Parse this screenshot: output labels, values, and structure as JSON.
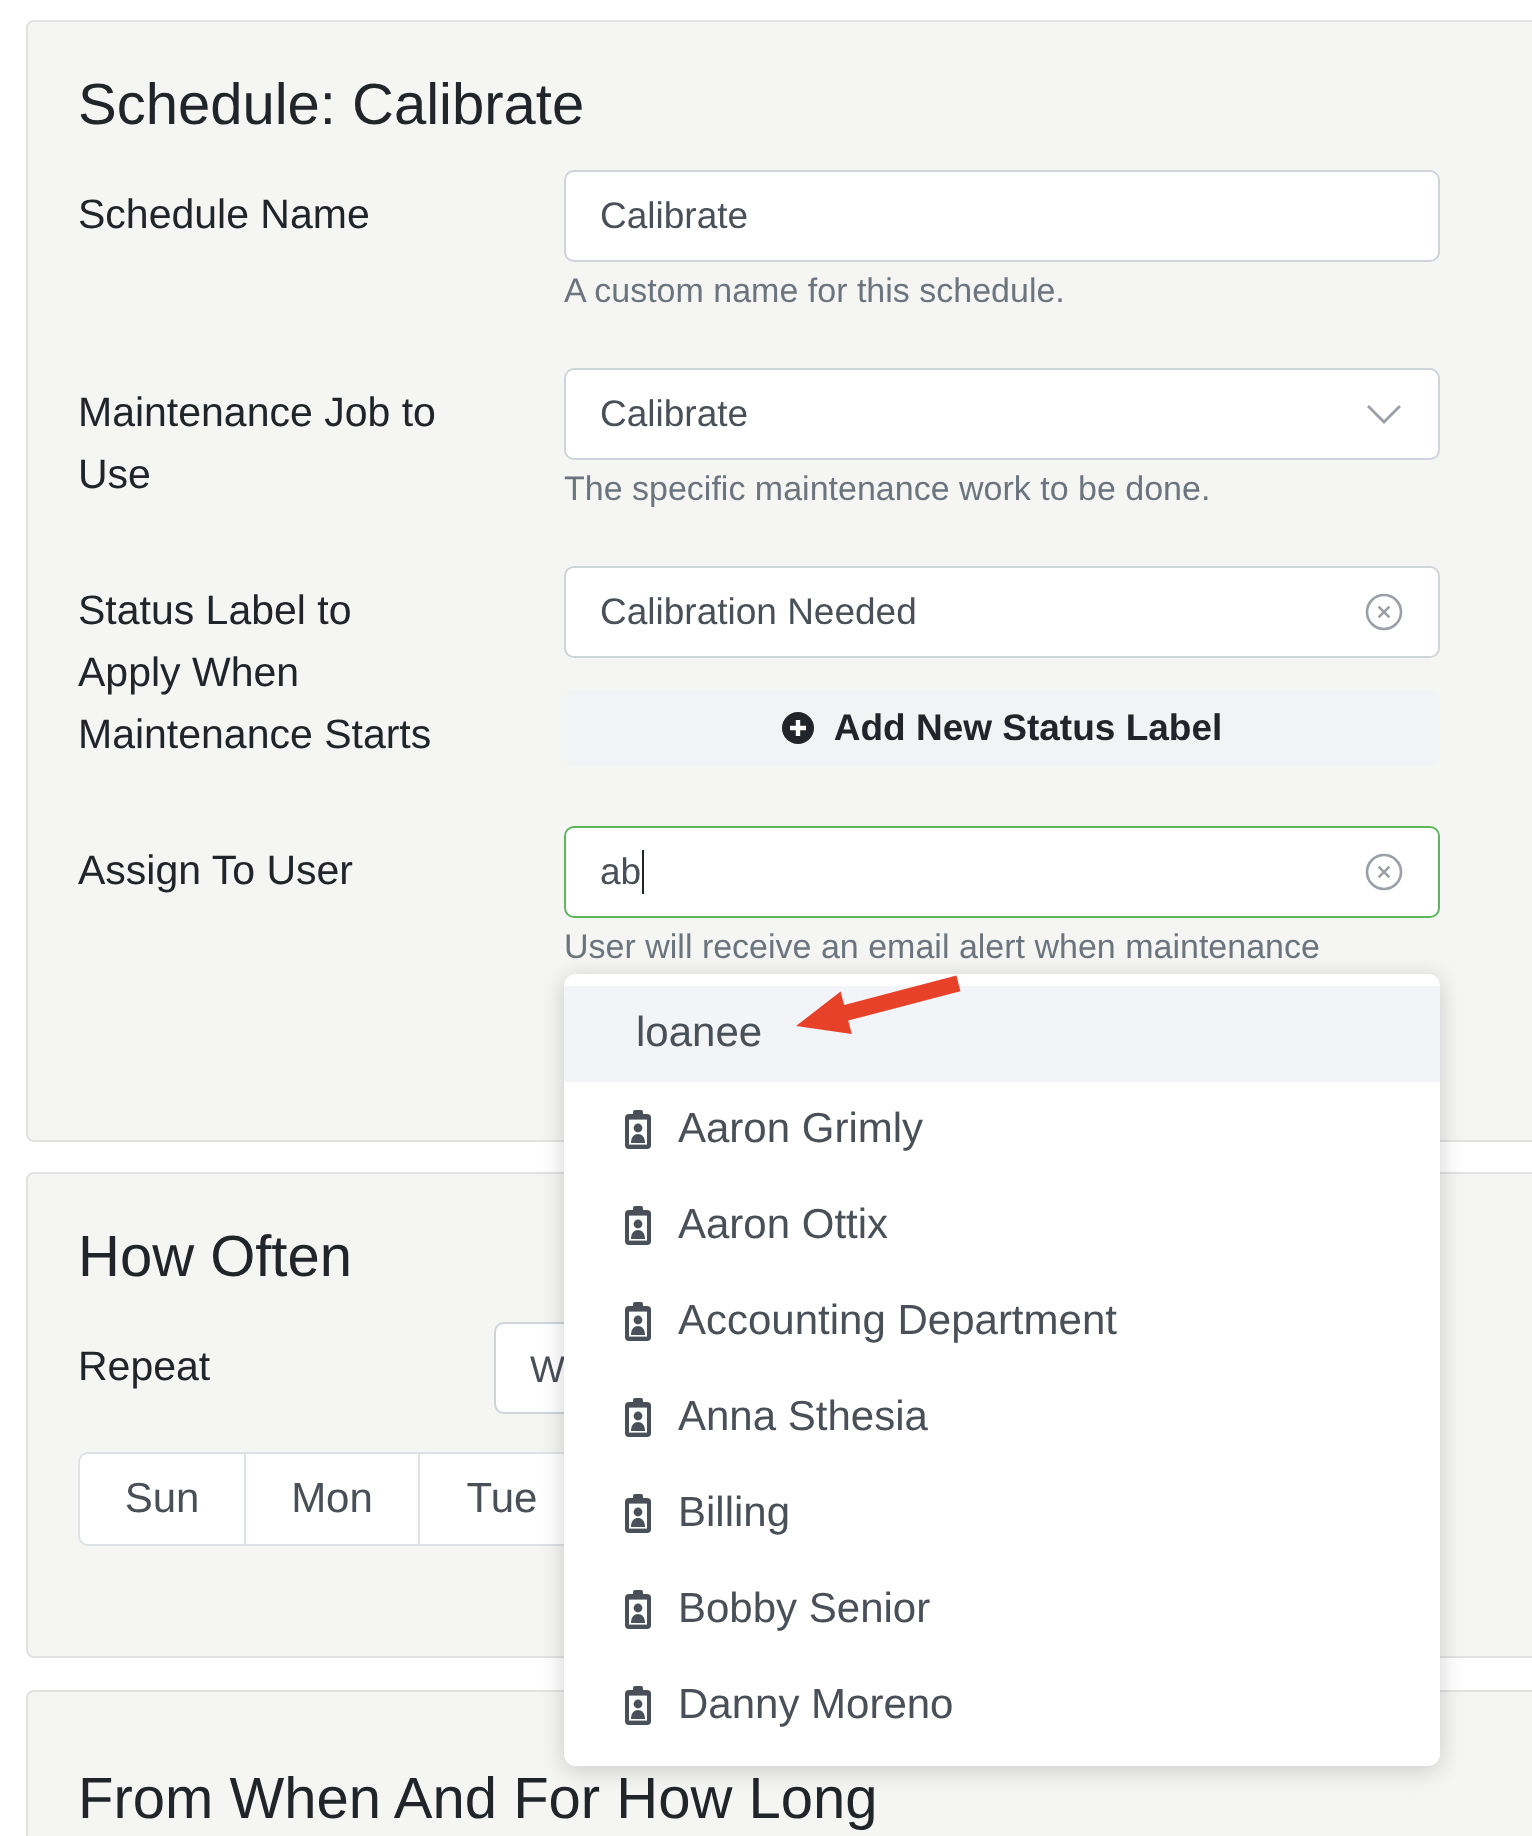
{
  "schedule": {
    "title": "Schedule: Calibrate",
    "fields": [
      {
        "kind": "text",
        "label": "Schedule Name",
        "value": "Calibrate",
        "hint": "A custom name for this schedule."
      },
      {
        "kind": "select",
        "label": "Maintenance Job to Use",
        "value": "Calibrate",
        "hint": "The specific maintenance work to be done."
      },
      {
        "kind": "clearable",
        "label": "Status Label to Apply When Maintenance Starts",
        "value": "Calibration Needed",
        "action": "Add New Status Label"
      },
      {
        "kind": "search",
        "label": "Assign To User",
        "value": "ab",
        "focused": true,
        "hint": "User will receive an email alert when maintenance"
      }
    ]
  },
  "user_dropdown": {
    "options": [
      {
        "kind": "plain",
        "label": "loanee",
        "selected": true
      },
      {
        "kind": "user",
        "label": "Aaron Grimly",
        "selected": false
      },
      {
        "kind": "user",
        "label": "Aaron Ottix",
        "selected": false
      },
      {
        "kind": "user",
        "label": "Accounting Department",
        "selected": false
      },
      {
        "kind": "user",
        "label": "Anna Sthesia",
        "selected": false
      },
      {
        "kind": "user",
        "label": "Billing",
        "selected": false
      },
      {
        "kind": "user",
        "label": "Bobby Senior",
        "selected": false
      },
      {
        "kind": "user",
        "label": "Danny Moreno",
        "selected": false
      }
    ]
  },
  "how_often": {
    "title": "How Often",
    "repeat_label": "Repeat",
    "repeat_value": "W",
    "days": [
      "Sun",
      "Mon",
      "Tue"
    ]
  },
  "from_when": {
    "title": "From When And For How Long"
  },
  "annotation": {
    "kind": "arrow"
  }
}
